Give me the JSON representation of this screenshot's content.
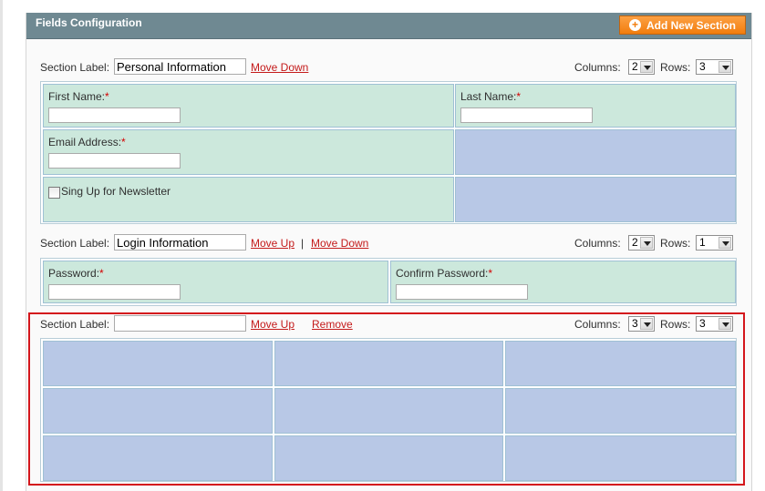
{
  "header": {
    "title": "Fields Configuration",
    "add_button": "Add New Section"
  },
  "labels": {
    "section_label": "Section Label:",
    "columns": "Columns:",
    "rows": "Rows:"
  },
  "sections": [
    {
      "label_value": "Personal Information",
      "actions": [
        "Move Down"
      ],
      "columns": "2",
      "rows": "3",
      "fields": [
        {
          "label": "First Name:",
          "required_mark": "*"
        },
        {
          "label": "Last Name:",
          "required_mark": "*"
        },
        {
          "label": "Email Address:",
          "required_mark": "*"
        },
        {
          "label": "Sing Up for Newsletter"
        }
      ]
    },
    {
      "label_value": "Login Information",
      "actions": [
        "Move Up",
        "Move Down"
      ],
      "separator": "|",
      "columns": "2",
      "rows": "1",
      "fields": [
        {
          "label": "Password:",
          "required_mark": "*"
        },
        {
          "label": "Confirm Password:",
          "required_mark": "*"
        }
      ]
    },
    {
      "label_value": "",
      "actions": [
        "Move Up",
        "Remove"
      ],
      "columns": "3",
      "rows": "3",
      "fields": []
    }
  ],
  "colors": {
    "header_bg": "#6f8992",
    "button_orange": "#f27d0d",
    "link_red": "#c41a1a",
    "filled_cell": "#cce8dc",
    "empty_cell": "#b8c8e6",
    "highlight_red": "#d4161c"
  },
  "icons": {
    "add": "plus-circle-icon",
    "dropdown": "chevron-down-icon"
  }
}
